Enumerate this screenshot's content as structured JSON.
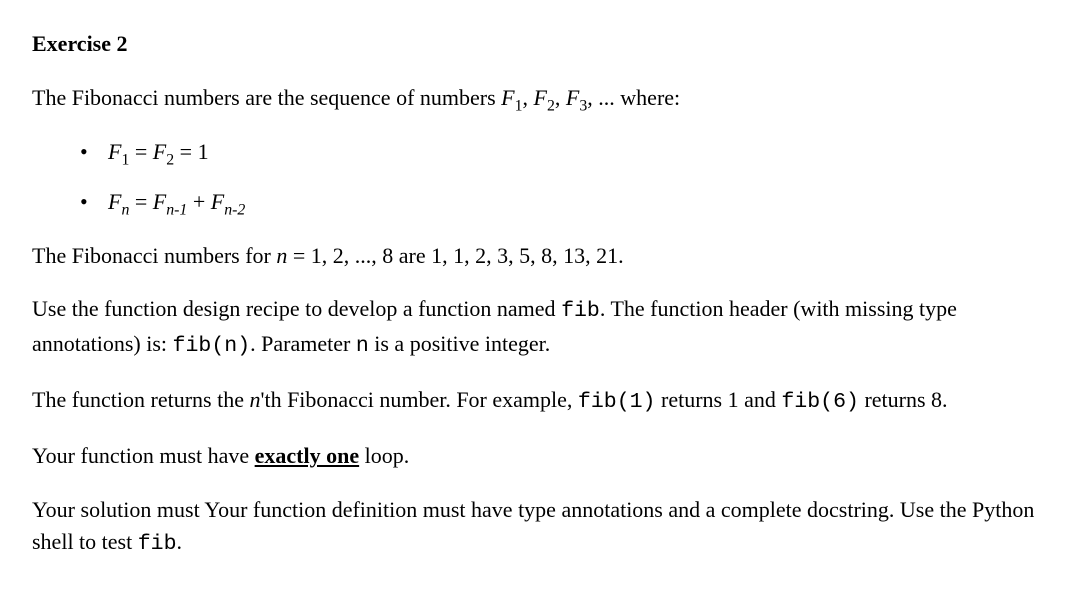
{
  "heading": "Exercise 2",
  "intro": {
    "t1": "The Fibonacci numbers are the sequence of numbers ",
    "F": "F",
    "sub1": "1",
    "c1": ", ",
    "sub2": "2",
    "c2": ", ",
    "sub3": "3",
    "c3": ", ... where:"
  },
  "bullet1": {
    "F": "F",
    "sub1": "1",
    "eq1": " = ",
    "sub2": "2",
    "eq2": " = 1"
  },
  "bullet2": {
    "F": "F",
    "subn": "n",
    "eq": " = ",
    "subnm1": "n-1",
    "plus": " + ",
    "subnm2": "n-2"
  },
  "seq": {
    "t1": "The Fibonacci numbers for ",
    "n": "n",
    "t2": " = 1, 2, ..., 8 are 1, 1, 2, 3, 5, 8, 13, 21."
  },
  "design": {
    "t1": "Use the function design recipe to develop a function named ",
    "fib": "fib",
    "t2": ". The function header (with missing type annotations) is: ",
    "fibn": "fib(n)",
    "t3": ". Parameter ",
    "n": "n",
    "t4": " is a positive integer."
  },
  "ret": {
    "t1": "The function returns the ",
    "n": "n",
    "t2": "'th Fibonacci number. For example, ",
    "fib1": "fib(1)",
    "t3": " returns 1 and ",
    "fib6": "fib(6)",
    "t4": " returns 8."
  },
  "loop": {
    "t1": "Your function must have ",
    "exact": "exactly one",
    "t2": " loop."
  },
  "final": {
    "t1": "Your solution must Your function definition must have type annotations and a complete docstring. Use the Python shell to test ",
    "fib": "fib",
    "t2": "."
  }
}
